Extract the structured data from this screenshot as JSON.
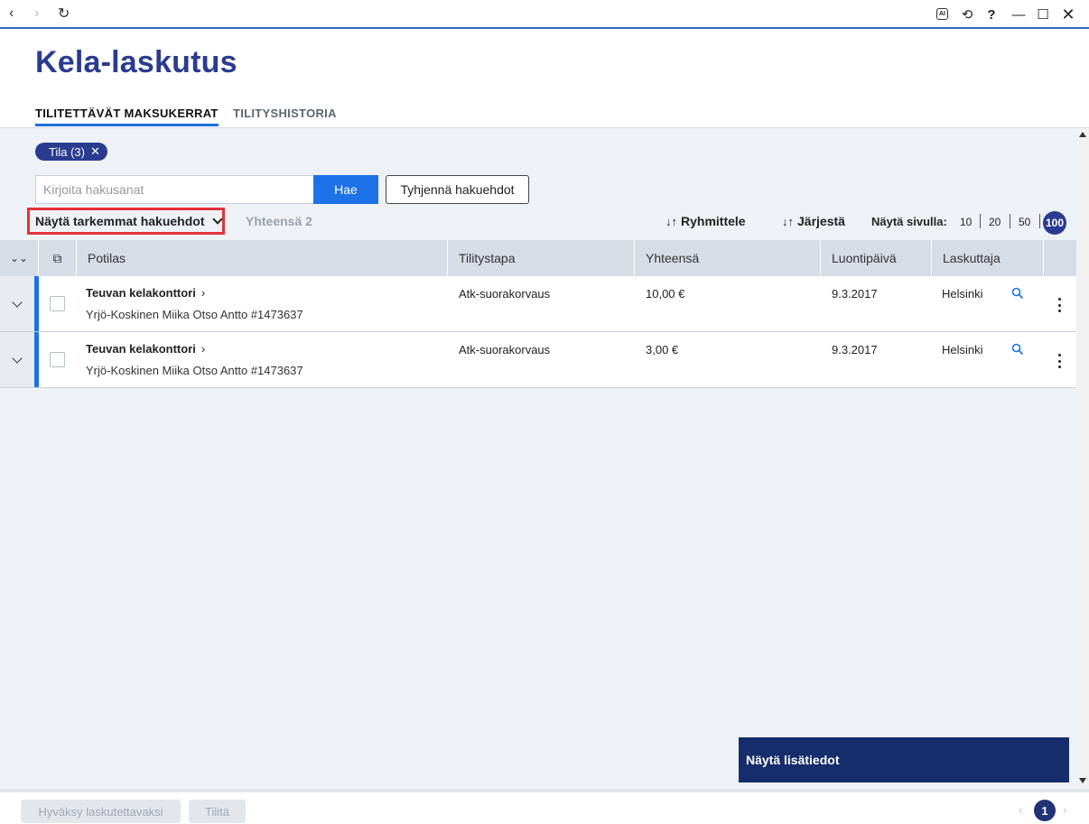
{
  "app": {
    "title": "Kela-laskutus"
  },
  "tabs": [
    {
      "label": "TILITETTÄVÄT MAKSUKERRAT",
      "active": true
    },
    {
      "label": "TILITYSHISTORIA",
      "active": false
    }
  ],
  "filters": {
    "chip_label": "Tila (3)",
    "chip_close": "✕"
  },
  "search": {
    "placeholder": "Kirjoita hakusanat",
    "value": "",
    "submit_label": "Hae",
    "clear_label": "Tyhjennä hakuehdot"
  },
  "toolbar": {
    "advanced_label": "Näytä tarkemmat hakuehdot",
    "total_label": "Yhteensä 2",
    "group_label": "Ryhmittele",
    "sort_label": "Järjestä",
    "per_page_label": "Näytä sivulla:",
    "per_page_options": [
      "10",
      "20",
      "50",
      "100"
    ],
    "per_page_selected": "100"
  },
  "table": {
    "columns": [
      "Potilas",
      "Tilitystapa",
      "Yhteensä",
      "Luontipäivä",
      "Laskuttaja"
    ],
    "rows": [
      {
        "office": "Teuvan kelakonttori",
        "patient": "Yrjö-Koskinen Miika Otso Antto #1473637",
        "method": "Atk-suorakorvaus",
        "total": "10,00 €",
        "date": "9.3.2017",
        "biller": "Helsinki"
      },
      {
        "office": "Teuvan kelakonttori",
        "patient": "Yrjö-Koskinen Miika Otso Antto #1473637",
        "method": "Atk-suorakorvaus",
        "total": "3,00 €",
        "date": "9.3.2017",
        "biller": "Helsinki"
      }
    ]
  },
  "info_panel": {
    "label": "Näytä lisätiedot"
  },
  "footer": {
    "approve_label": "Hyväksy laskutettavaksi",
    "settle_label": "Tilitä",
    "current_page": "1"
  },
  "colors": {
    "brand": "#2a3c8f",
    "accent": "#1d72e8",
    "highlight": "#e3323a"
  }
}
